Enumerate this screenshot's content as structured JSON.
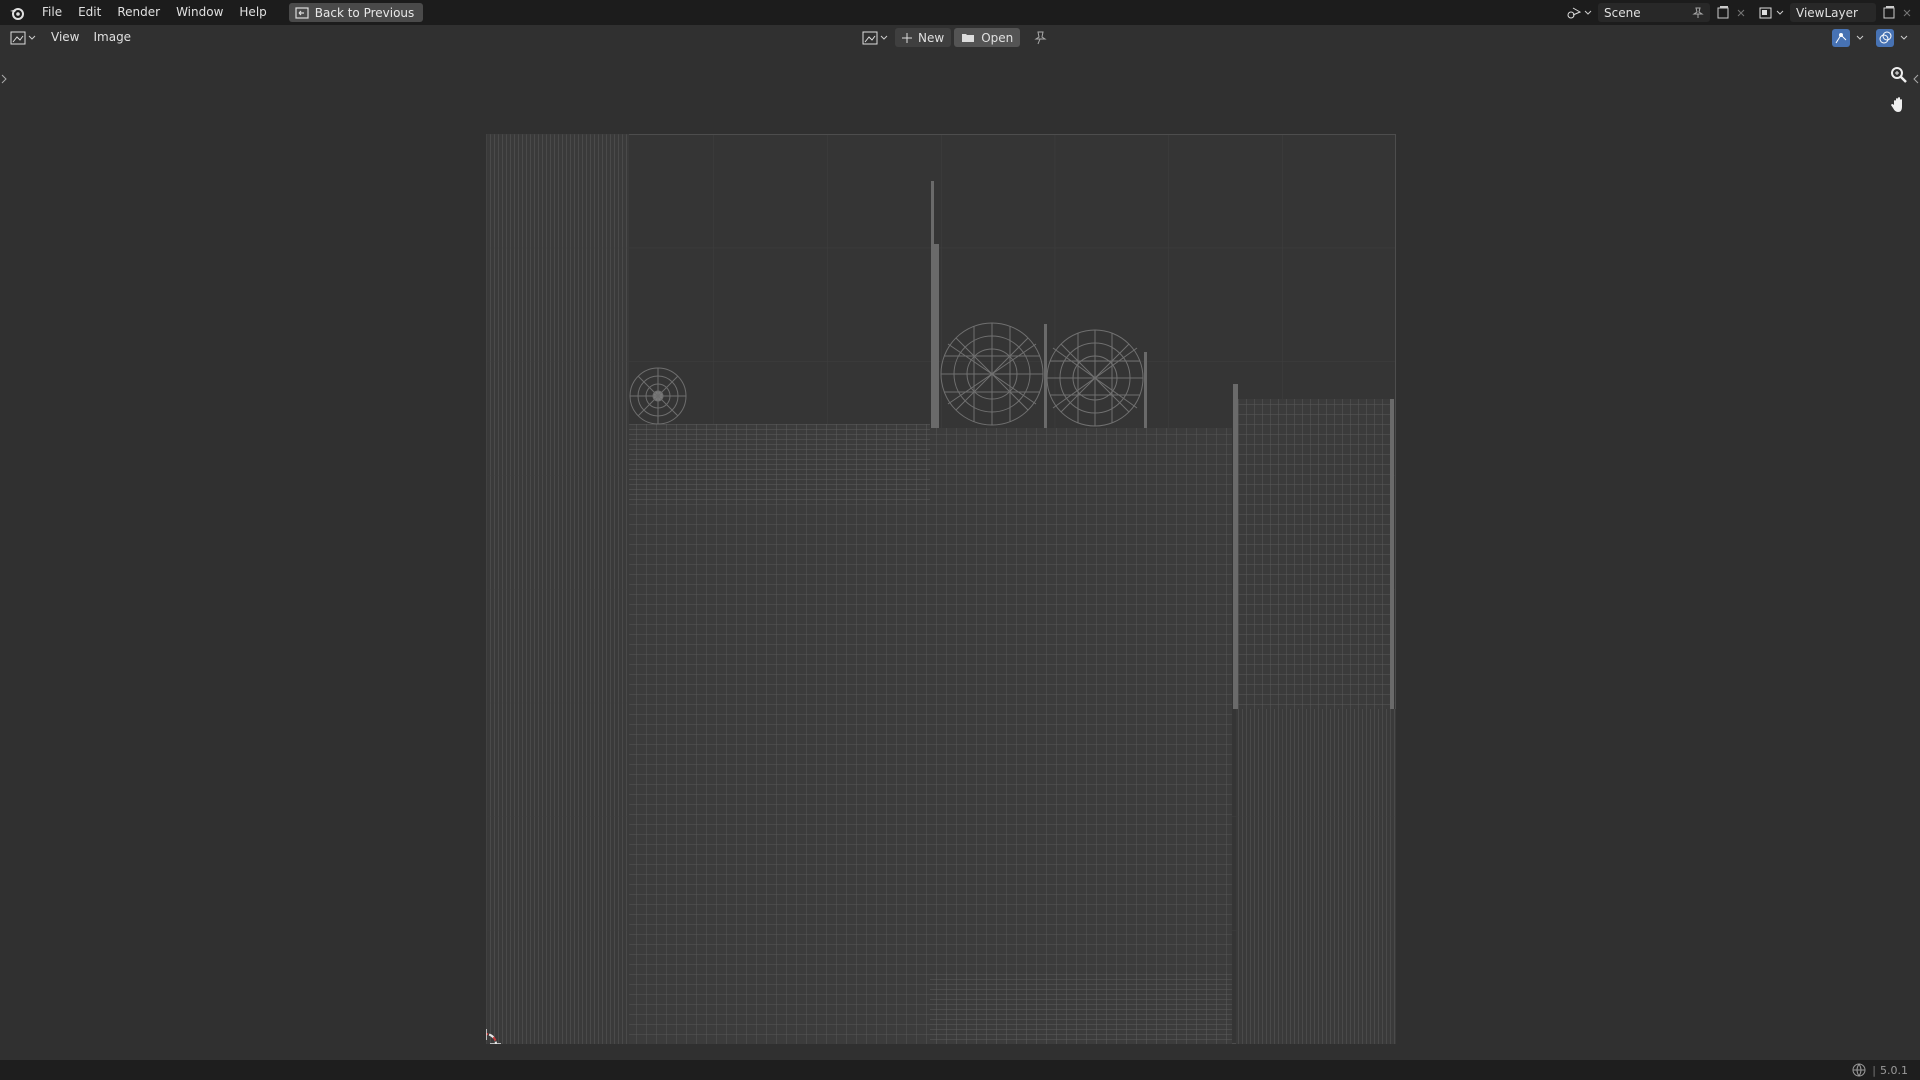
{
  "topbar": {
    "menus": [
      "File",
      "Edit",
      "Render",
      "Window",
      "Help"
    ],
    "back_button": "Back to Previous",
    "scene": "Scene",
    "view_layer": "ViewLayer"
  },
  "header": {
    "menus": [
      "View",
      "Image"
    ],
    "new_label": "New",
    "open_label": "Open"
  },
  "status": {
    "version": "5.0.1"
  },
  "icons": {
    "app": "blender-logo-icon",
    "back": "back-screen-icon",
    "scene": "scene-icon",
    "view_layer": "view-layer-icon",
    "zoom": "zoom-icon",
    "pan": "hand-icon",
    "cursor": "2d-cursor-icon"
  },
  "colors": {
    "background": "#303030",
    "topbar": "#1c1c1c",
    "uv_wire": "#8a8a8a",
    "cursor": "#c83c3c"
  }
}
